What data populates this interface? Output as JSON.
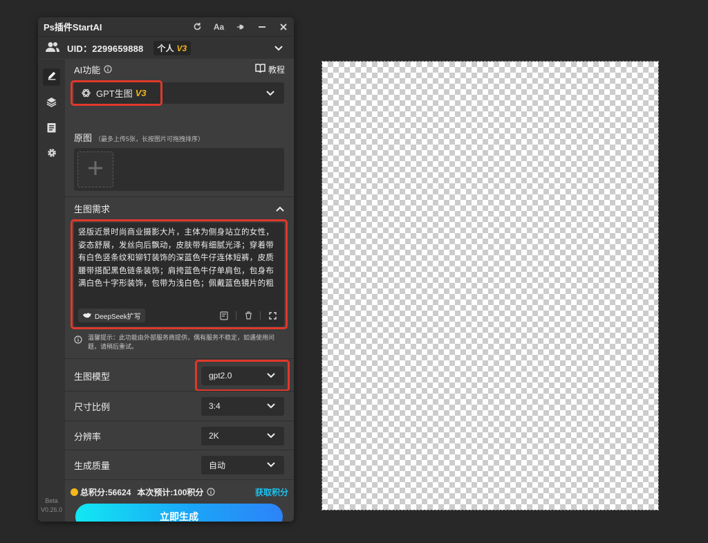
{
  "window": {
    "title": "Ps插件StartAI"
  },
  "titlebar": {
    "font_button_label": "Aa"
  },
  "user": {
    "uid": "UID：2299659888",
    "plan": "个人",
    "plan_badge": "V3"
  },
  "ai_function": {
    "label": "AI功能",
    "tutorial_label": "教程",
    "selected": "GPT生图",
    "selected_badge": "V3"
  },
  "original_image": {
    "label": "原图",
    "hint": "（最多上传5张，长按图片可拖拽排序）"
  },
  "requirement": {
    "label": "生图需求",
    "prompt": "竖版近景时尚商业摄影大片，主体为侧身站立的女性，姿态舒展，发丝向后飘动，皮肤带有细腻光泽；穿着带有白色竖条纹和铆钉装饰的深蓝色牛仔连体短裤，皮质腰带搭配黑色链条装饰；肩挎蓝色牛仔单肩包，包身布满白色十字形装饰，包带为浅白色；佩戴蓝色镜片的粗框黑墨镜，银",
    "deepseek_label": "DeepSeek扩写"
  },
  "notice": "温馨提示：此功能由外部服务商提供，偶有服务不稳定，如遇使用问题，请稍后重试。",
  "options": {
    "model": {
      "label": "生图模型",
      "value": "gpt2.0"
    },
    "ratio": {
      "label": "尺寸比例",
      "value": "3:4"
    },
    "resolution": {
      "label": "分辨率",
      "value": "2K"
    },
    "quality": {
      "label": "生成质量",
      "value": "自动"
    }
  },
  "points": {
    "total": "总积分:56624",
    "estimate": "本次预计:100积分",
    "get_label": "获取积分"
  },
  "generate_button": "立即生成",
  "version": {
    "stage": "Beta",
    "number": "V0.26.0"
  },
  "colors": {
    "accent_red": "#e0392b",
    "badge_gold": "#f3b519",
    "link_cyan": "#1ec2f0",
    "button_gradient_start": "#12e8f3",
    "button_gradient_end": "#2d83f8"
  }
}
